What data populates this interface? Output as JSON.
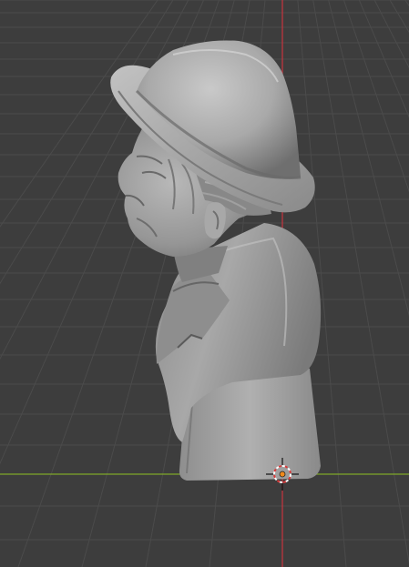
{
  "viewport": {
    "background_color": "#3d3d3d",
    "grid_color": "#4a4a4a",
    "x_axis_color": "#7fa72a",
    "z_axis_color": "#c8343e",
    "model_color": "#9a9a9a",
    "model_highlight_color": "#bdbdbd",
    "model_shadow_color": "#5e5e5e",
    "origin_icon": "3d-cursor-icon"
  }
}
